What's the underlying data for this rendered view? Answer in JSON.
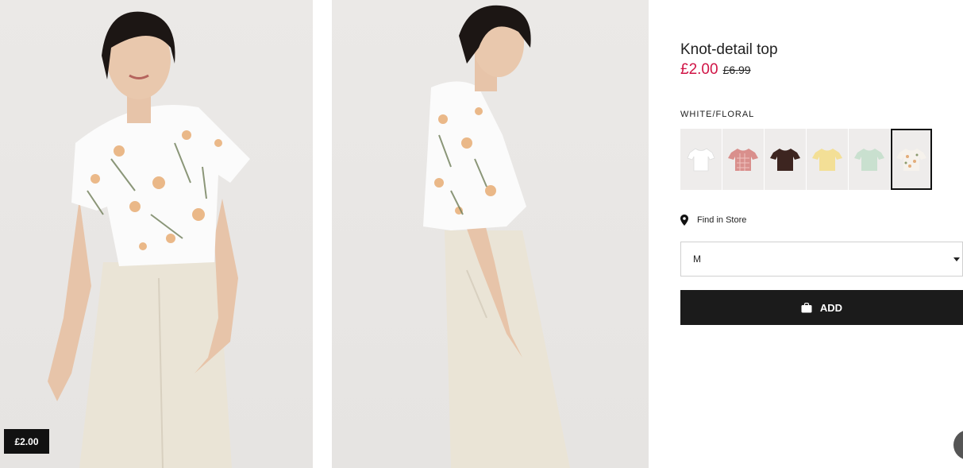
{
  "product": {
    "title": "Knot-detail top",
    "price_current": "£2.00",
    "price_original": "£6.99",
    "color_label": "WHITE/FLORAL",
    "badge_price": "£2.00"
  },
  "swatches": [
    {
      "name": "white",
      "color": "#ffffff",
      "selected": false
    },
    {
      "name": "pink-check",
      "color": "#d98f8c",
      "selected": false
    },
    {
      "name": "dark-brown",
      "color": "#3d2520",
      "selected": false
    },
    {
      "name": "light-yellow",
      "color": "#f3df96",
      "selected": false
    },
    {
      "name": "mint-green",
      "color": "#c9e0cf",
      "selected": false
    },
    {
      "name": "white-floral",
      "color": "#f4eee6",
      "selected": true
    }
  ],
  "find_in_store": {
    "label": "Find in Store",
    "icon": "map-pin-icon"
  },
  "size_select": {
    "value": "M"
  },
  "add_button": {
    "label": "ADD",
    "icon": "shopping-bag-icon"
  },
  "colors": {
    "sale_red": "#d01345",
    "button_black": "#1b1b1b"
  }
}
